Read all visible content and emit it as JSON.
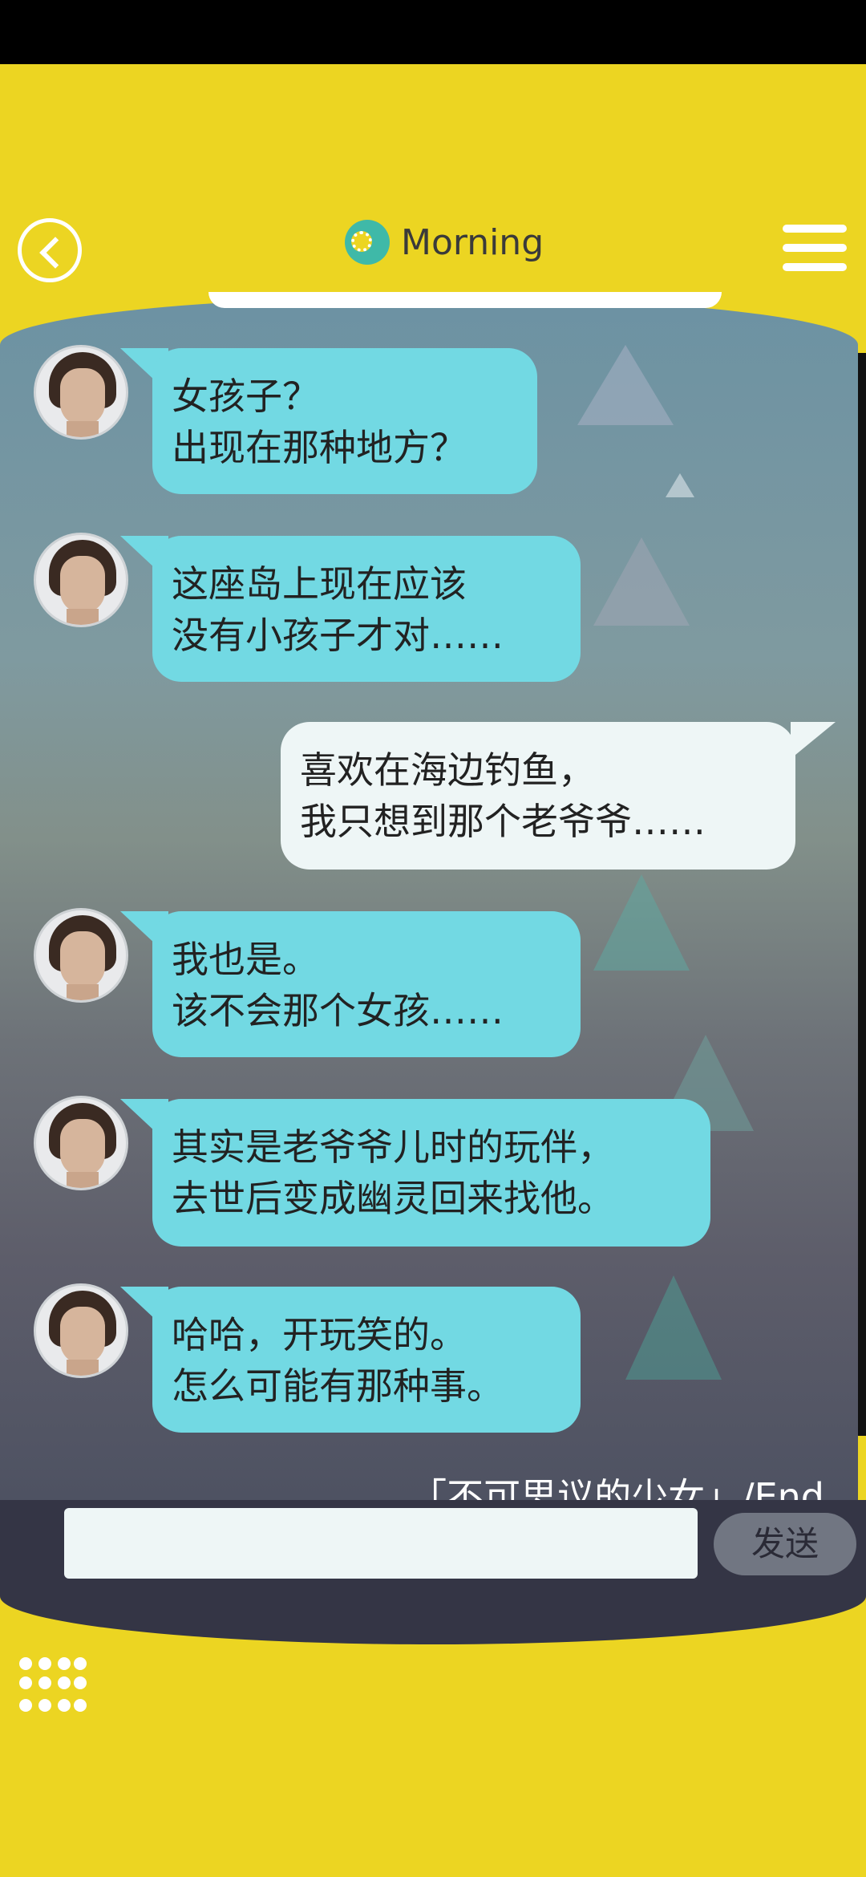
{
  "header": {
    "title": "Morning",
    "title_icon": "gear-icon",
    "back_icon": "back-arrow-icon",
    "menu_icon": "hamburger-menu-icon"
  },
  "messages": [
    {
      "side": "left",
      "text": "女孩子？\n出现在那种地方？"
    },
    {
      "side": "left",
      "text": "这座岛上现在应该\n没有小孩子才对……"
    },
    {
      "side": "right",
      "text": "喜欢在海边钓鱼，\n我只想到那个老爷爷……"
    },
    {
      "side": "left",
      "text": "我也是。\n该不会那个女孩……"
    },
    {
      "side": "left",
      "text": "其实是老爷爷儿时的玩伴，\n去世后变成幽灵回来找他。"
    },
    {
      "side": "left",
      "text": "哈哈，开玩笑的。\n怎么可能有那种事。"
    }
  ],
  "end_text": "「不可思议的少女」/End",
  "input": {
    "value": "",
    "placeholder": ""
  },
  "send_label": "发送",
  "colors": {
    "background": "#ecd522",
    "bubble_left": "#72d9e3",
    "bubble_right": "#eef6f6",
    "input_bar": "#343545"
  }
}
